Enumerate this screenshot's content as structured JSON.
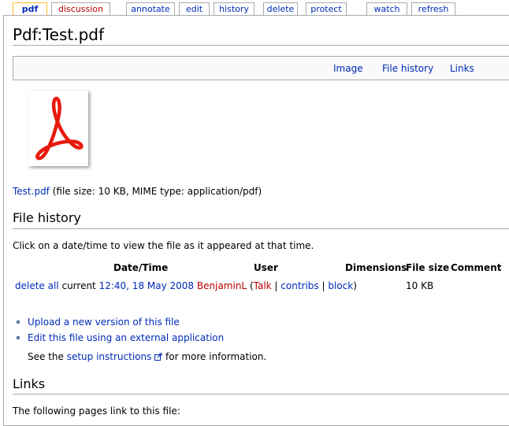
{
  "tabs": [
    {
      "label": "pdf",
      "selected": true,
      "color": "blue"
    },
    {
      "label": "discussion",
      "selected": false,
      "color": "red"
    },
    {
      "label": "annotate",
      "selected": false,
      "color": "blue"
    },
    {
      "label": "edit",
      "selected": false,
      "color": "blue"
    },
    {
      "label": "history",
      "selected": false,
      "color": "blue"
    },
    {
      "label": "delete",
      "selected": false,
      "color": "blue"
    },
    {
      "label": "protect",
      "selected": false,
      "color": "blue"
    },
    {
      "label": "watch",
      "selected": false,
      "color": "blue"
    },
    {
      "label": "refresh",
      "selected": false,
      "color": "blue"
    }
  ],
  "page": {
    "title": "Pdf:Test.pdf"
  },
  "filetoc": {
    "image": "Image",
    "file_history": "File history",
    "links": "Links"
  },
  "file_info": {
    "name": "Test.pdf",
    "details": "(file size: 10 KB, MIME type: application/pdf)"
  },
  "history": {
    "heading": "File history",
    "intro": "Click on a date/time to view the file as it appeared at that time.",
    "columns": {
      "datetime": "Date/Time",
      "user": "User",
      "dimensions": "Dimensions",
      "filesize": "File size",
      "comment": "Comment"
    },
    "row": {
      "delete_all": "delete all",
      "current": "current",
      "datetime": "12:40, 18 May 2008",
      "user": "BenjaminL",
      "talk": "Talk",
      "contribs": "contribs",
      "block": "block",
      "filesize": "10 KB"
    }
  },
  "actions": {
    "upload": "Upload a new version of this file",
    "edit_external": "Edit this file using an external application",
    "see_the": "See the",
    "setup_instructions": "setup instructions",
    "more_info": "for more information."
  },
  "links": {
    "heading": "Links",
    "intro": "The following pages link to this file:"
  },
  "colors": {
    "link": "#002bb8",
    "new_link": "#ba0000",
    "selected_tab_border": "#fabd23",
    "border": "#aaaaaa",
    "bullet": "#5e7aa8"
  },
  "icons": {
    "file_thumb": "pdf-acrobat-icon",
    "external": "external-link-icon"
  }
}
